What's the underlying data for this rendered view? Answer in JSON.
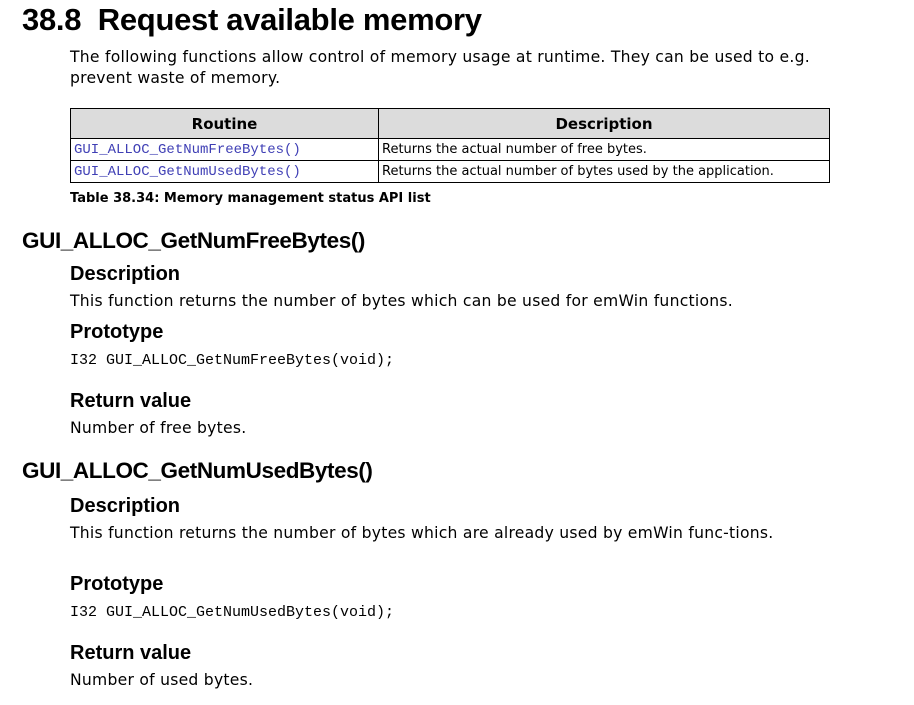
{
  "section": {
    "number": "38.8",
    "title": "Request available memory",
    "intro": "The following functions allow control of memory usage at runtime. They can be used to e.g. prevent waste of memory."
  },
  "table": {
    "headers": [
      "Routine",
      "Description"
    ],
    "rows": [
      {
        "routine": "GUI_ALLOC_GetNumFreeBytes()",
        "description": "Returns the actual number of free bytes."
      },
      {
        "routine": "GUI_ALLOC_GetNumUsedBytes()",
        "description": "Returns the actual number of bytes used by the application."
      }
    ],
    "caption": "Table 38.34: Memory management status API list"
  },
  "functions": [
    {
      "name": "GUI_ALLOC_GetNumFreeBytes()",
      "description_heading": "Description",
      "description": "This function returns the number of bytes which can be used for emWin functions.",
      "prototype_heading": "Prototype",
      "prototype": "I32 GUI_ALLOC_GetNumFreeBytes(void);",
      "return_heading": "Return value",
      "return_value": "Number of free bytes."
    },
    {
      "name": "GUI_ALLOC_GetNumUsedBytes()",
      "description_heading": "Description",
      "description": "This function returns the number of bytes which are already used by emWin func-tions.",
      "prototype_heading": "Prototype",
      "prototype": "I32 GUI_ALLOC_GetNumUsedBytes(void);",
      "return_heading": "Return value",
      "return_value": "Number of used bytes."
    }
  ],
  "colors": {
    "link": "#3f3fb5",
    "header_bg": "#dcdcdc"
  }
}
